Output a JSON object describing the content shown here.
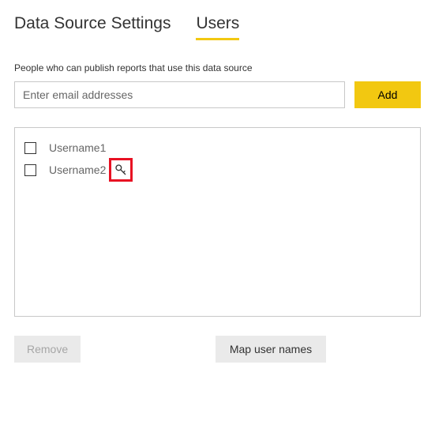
{
  "tabs": {
    "data_source": "Data Source Settings",
    "users": "Users"
  },
  "description": "People who can publish reports that use this data source",
  "email_input": {
    "placeholder": "Enter email addresses",
    "value": ""
  },
  "add_label": "Add",
  "users_list": [
    {
      "name": "Username1",
      "has_key": false
    },
    {
      "name": "Username2",
      "has_key": true
    }
  ],
  "remove_label": "Remove",
  "map_label": "Map user names",
  "colors": {
    "accent": "#f2c811",
    "highlight_border": "#e81123"
  }
}
